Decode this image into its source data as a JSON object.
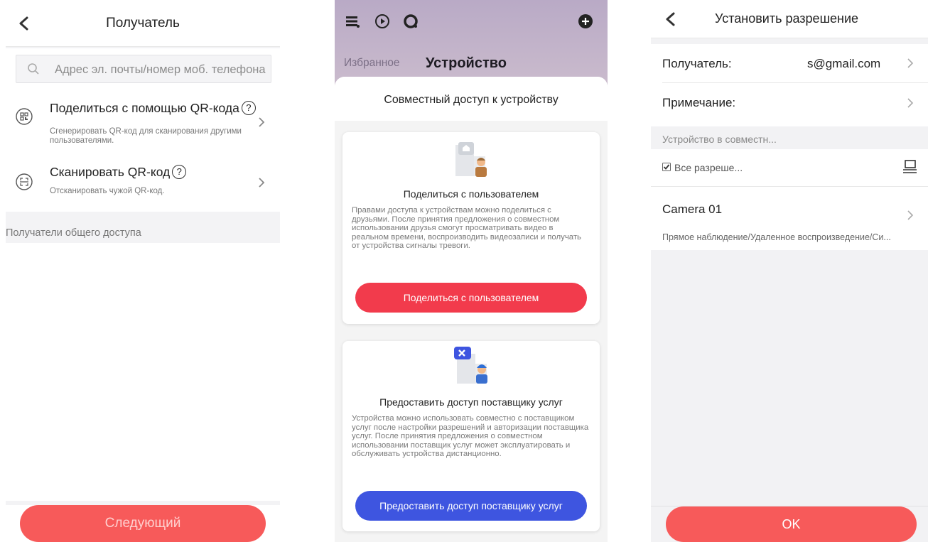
{
  "screen1": {
    "title": "Получатель",
    "search_placeholder": "Адрес эл. почты/номер моб. телефона",
    "share_qr": {
      "title": "Поделиться с помощью QR-кода",
      "help": "?",
      "description": "Сгенерировать QR-код для сканирования другими пользователями."
    },
    "scan_qr": {
      "title": "Сканировать QR-код",
      "help": "?",
      "description": "Отсканировать чужой QR-код."
    },
    "recipients_section": "Получатели общего доступа",
    "next_button": "Следующий"
  },
  "screen2": {
    "tabs": [
      "Избранное",
      "Устройство"
    ],
    "sheet_title": "Совместный доступ к устройству",
    "share_user_card": {
      "title": "Поделиться с пользователем",
      "description": "Правами доступа к устройствам можно поделиться с друзьями. После принятия предложения о совместном использовании друзья смогут просматривать видео в реальном времени, воспроизводить видеозаписи и получать от устройства сигналы тревоги.",
      "button": "Поделиться с пользователем",
      "button_color": "#f23b4c"
    },
    "provider_card": {
      "title": "Предоставить доступ поставщику услуг",
      "description": "Устройства можно использовать совместно с поставщиком услуг после настройки разрешений и авторизации поставщика услуг. После принятия предложения о совместном использовании поставщик услуг может эксплуатировать и обслуживать устройства дистанционно.",
      "button": "Предоставить доступ поставщику услуг",
      "button_color": "#3e55e0"
    }
  },
  "screen3": {
    "title": "Установить разрешение",
    "recipient_label": "Получатель:",
    "recipient_value": "s@gmail.com",
    "note_label": "Примечание:",
    "shared_device_header": "Устройство в совместн...",
    "all_permissions": "Все разреше...",
    "camera_name": "Camera 01",
    "camera_permissions": "Прямое наблюдение/Удаленное воспроизведение/Си...",
    "ok_button": "OK"
  },
  "colors": {
    "accent_red": "#f75a5a",
    "provider_blue": "#3e55e0",
    "header_purple": "#bcadc8"
  }
}
